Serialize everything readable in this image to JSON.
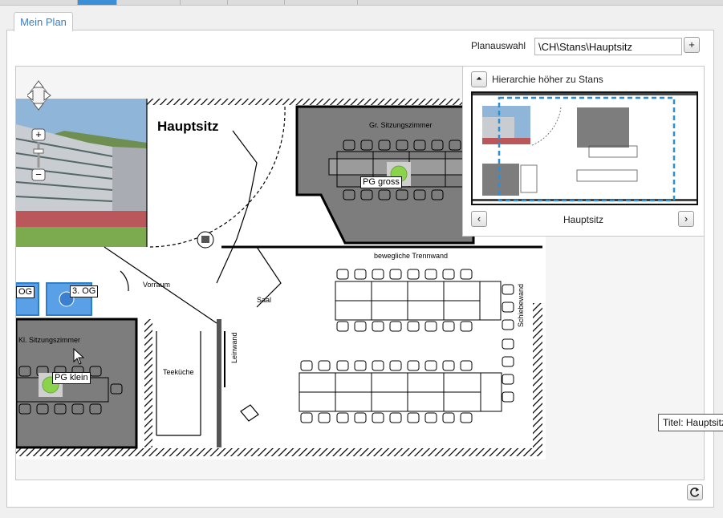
{
  "tab": {
    "label": "Mein Plan"
  },
  "plan_select": {
    "label": "Planauswahl",
    "value": "\\CH\\Stans\\Hauptsitz",
    "add_symbol": "+"
  },
  "minimap": {
    "up_label": "Hierarchie höher zu Stans",
    "current_name": "Hauptsitz",
    "prev_symbol": "‹",
    "next_symbol": "›"
  },
  "floorplan": {
    "title": "Hauptsitz",
    "rooms": {
      "gr_sitzung": "Gr. Sitzungszimmer",
      "kl_sitzung": "Kl. Sitzungszimmer",
      "vorraum": "Vorraum",
      "saal": "Saal",
      "teekueche": "Teeküche",
      "leinwand": "Leinwand",
      "trennwand": "bewegliche Trennwand",
      "schiebewand": "Schiebewand"
    },
    "markers": {
      "pg_gross": "PG gross",
      "pg_klein": "PG klein",
      "og2": "OG",
      "og3": "3. OG"
    }
  },
  "tooltip": {
    "text": "Titel: Hauptsitz"
  },
  "colors": {
    "accent": "#3b7dc4",
    "marker": "#8bd34a",
    "room_shade": "#7d7d7d"
  }
}
